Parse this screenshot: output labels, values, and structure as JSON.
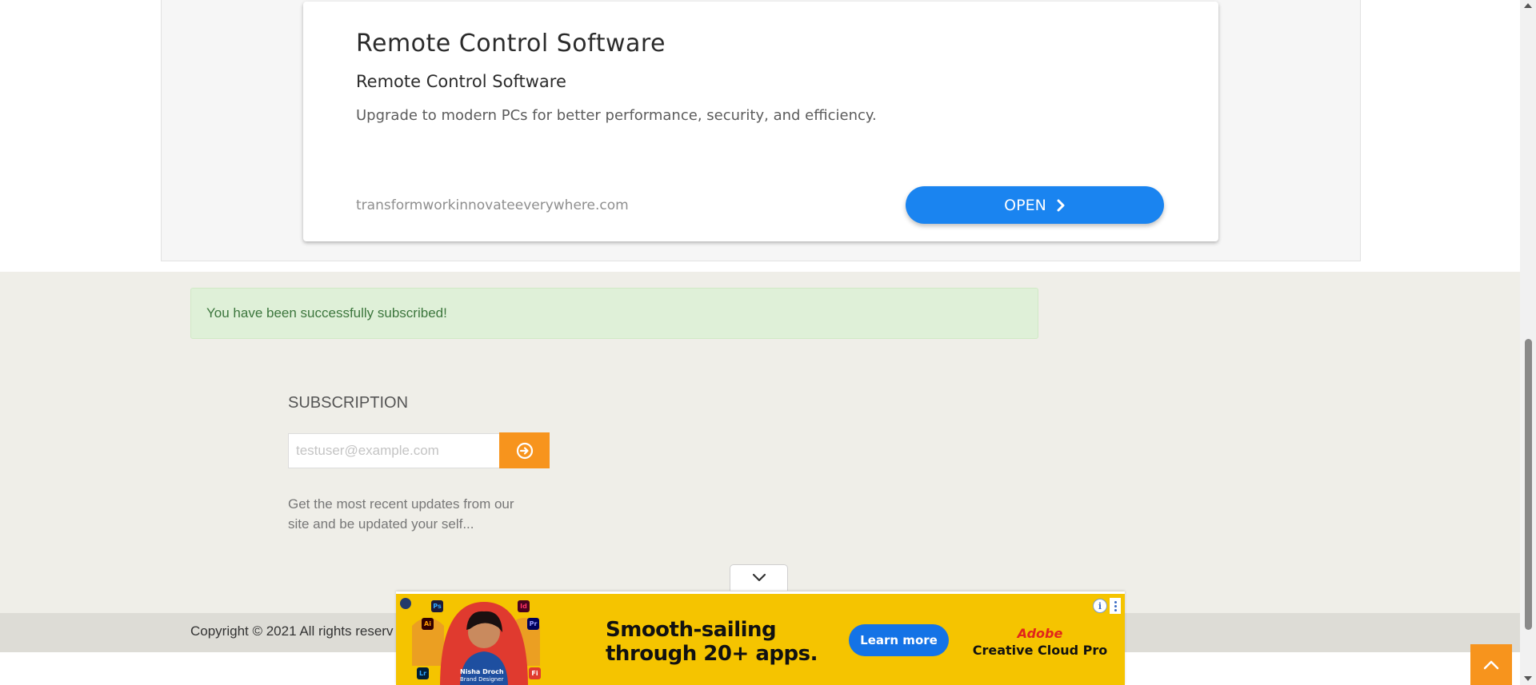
{
  "ad_card": {
    "title": "Remote Control Software",
    "subtitle": "Remote Control Software",
    "description": "Upgrade to modern PCs for better performance, security, and efficiency.",
    "domain": "transformworkinnovateeverywhere.com",
    "open_label": "OPEN",
    "accent_color": "#1a84f0"
  },
  "alert": {
    "message": "You have been successfully subscribed!"
  },
  "subscription": {
    "heading": "SUBSCRIPTION",
    "input_placeholder": "testuser@example.com",
    "submit_icon": "arrow-circle-right-icon",
    "description": "Get the most recent updates from our site and be updated your self...",
    "accent_color": "#f7941d"
  },
  "footer": {
    "copyright": "Copyright © 2021 All rights reserv"
  },
  "banner_ad": {
    "headline_line1": "Smooth-sailing",
    "headline_line2": "through 20+ apps.",
    "cta_label": "Learn more",
    "brand_name": "Adobe",
    "product_name": "Creative Cloud Pro",
    "person_name": "Nisha Droch",
    "person_role": "Brand Designer",
    "app_icons": [
      "Ps",
      "Id",
      "Ai",
      "Pr",
      "Lr",
      "Fi"
    ],
    "info_icon": "info-icon",
    "menu_icon": "more-vertical-icon"
  },
  "widgets": {
    "collapse_icon": "chevron-down-icon",
    "back_to_top_icon": "chevron-up-icon"
  }
}
